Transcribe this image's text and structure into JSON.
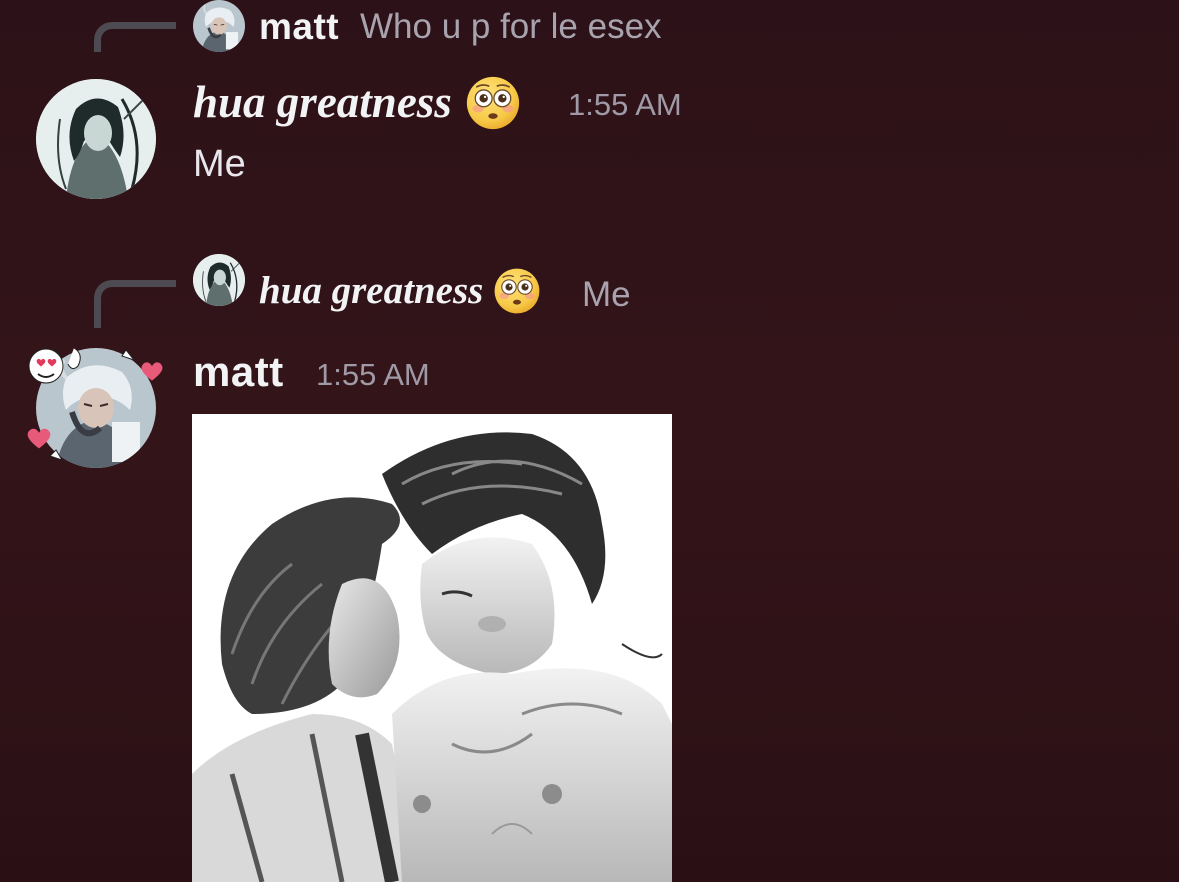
{
  "messages": [
    {
      "reply": {
        "author": "matt",
        "text": "Who u p for le esex"
      },
      "author": "hua greatness",
      "author_emoji": "flushed-face-icon",
      "timestamp": "1:55 AM",
      "text": "Me"
    },
    {
      "reply": {
        "author": "hua greatness",
        "author_emoji": "flushed-face-icon",
        "text": "Me"
      },
      "author": "matt",
      "timestamp": "1:55 AM",
      "attachment": "image-attachment"
    }
  ],
  "colors": {
    "background": "#2f1319",
    "reply_spine": "#4e4a52",
    "username": "#f2f3f5",
    "muted_text": "#a8a3ad",
    "emoji_yellow": "#f7c948"
  }
}
